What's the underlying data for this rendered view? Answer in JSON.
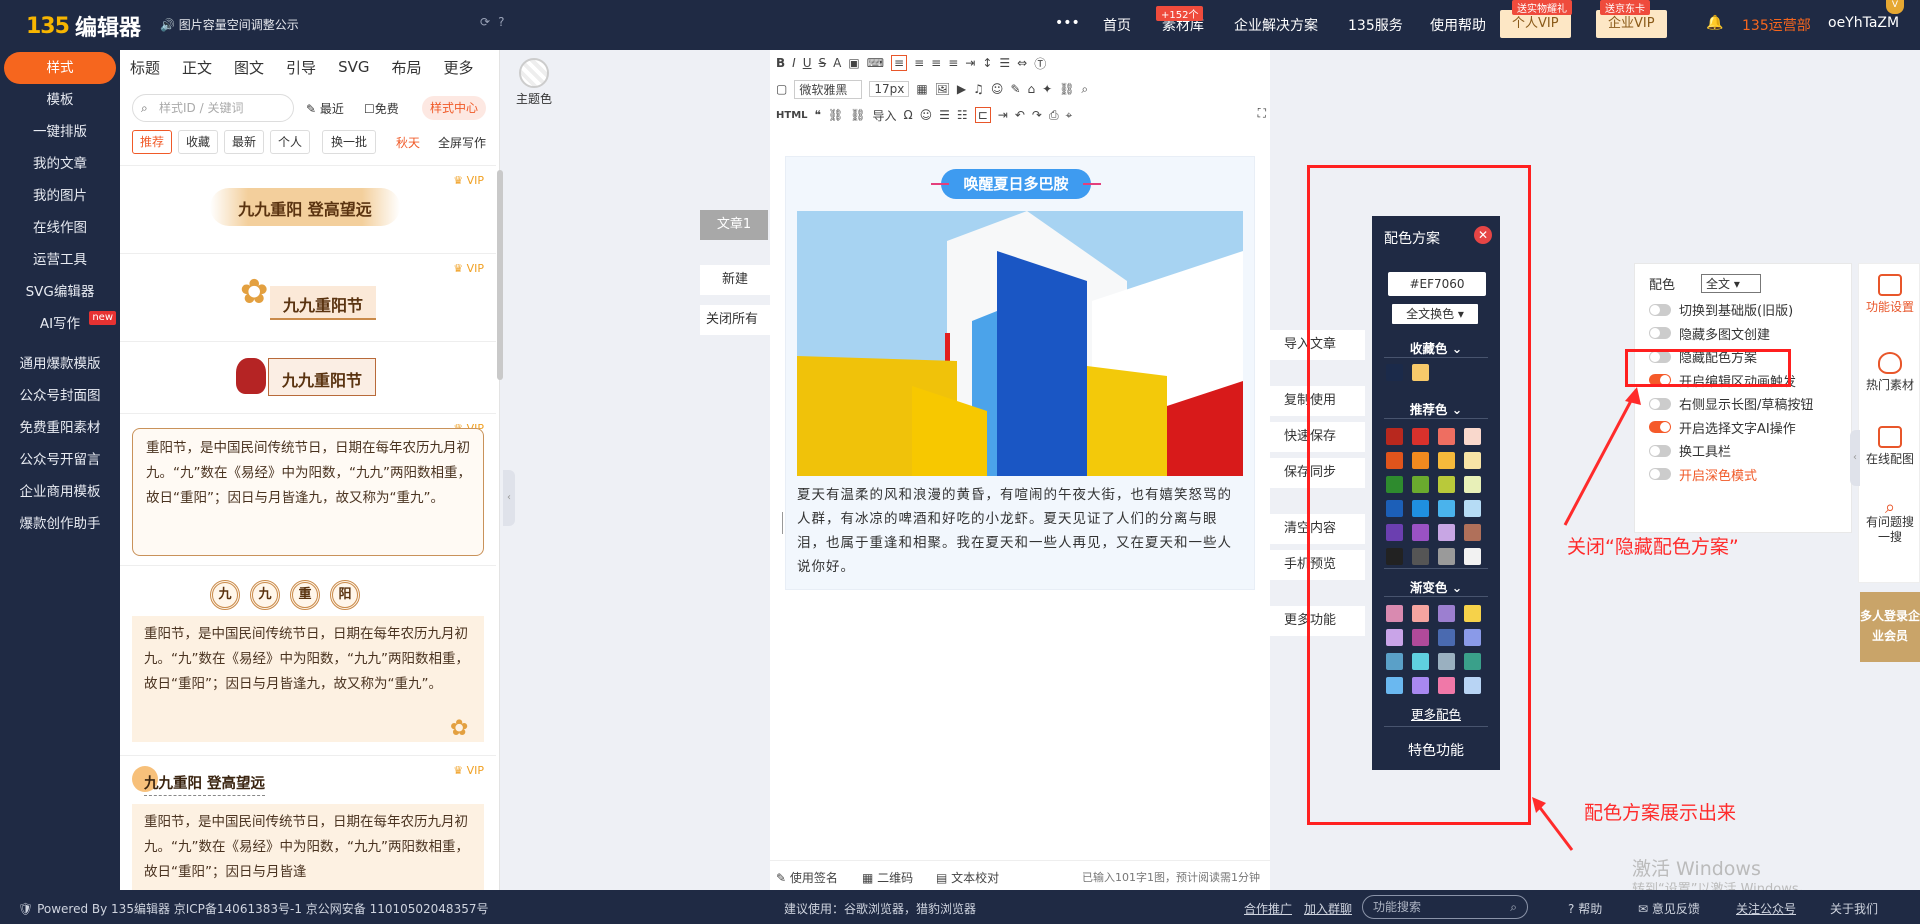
{
  "topbar": {
    "logo_mark": "135",
    "logo_name": "编辑器",
    "notice": "图片容量空间调整公示",
    "nav": [
      "首页",
      "素材库",
      "企业解决方案",
      "135服务",
      "使用帮助"
    ],
    "nav_badge": "+152个",
    "vip_personal": "个人VIP",
    "vip_personal_badge": "送实物耀礼",
    "vip_company": "企业VIP",
    "vip_company_badge": "送京东卡",
    "ops": "135运营部",
    "username": "oeYhTaZM"
  },
  "sidebar": {
    "items": [
      "样式",
      "模板",
      "一键排版",
      "我的文章",
      "我的图片",
      "在线作图",
      "运营工具",
      "SVG编辑器",
      "AI写作"
    ],
    "new_tag": "new",
    "extra": [
      "通用爆款模版",
      "公众号封面图",
      "免费重阳素材",
      "公众号开留言",
      "企业商用模板",
      "爆款创作助手"
    ]
  },
  "panel": {
    "tabs": [
      "标题",
      "正文",
      "图文",
      "引导",
      "SVG",
      "布局",
      "更多"
    ],
    "theme_label": "主题色",
    "search_placeholder": "样式ID / 关键词",
    "recent": "最近",
    "free": "免费",
    "style_center": "样式中心",
    "filters": [
      "推荐",
      "收藏",
      "最新",
      "个人",
      "换一批"
    ],
    "season": "秋天",
    "fullscreen": "全屏写作",
    "vip": "VIP",
    "tpl1": "九九重阳 登高望远",
    "tpl2": "九九重阳节",
    "tpl3": "九九重阳节",
    "tpl4_text": "重阳节，是中国民间传统节日，日期在每年农历九月初九。“九”数在《易经》中为阳数，“九九”两阳数相重，故日“重阳”；因日与月皆逢九，故又称为“重九”。",
    "tpl5_chars": [
      "九",
      "九",
      "重",
      "阳"
    ],
    "tpl5_text": "重阳节，是中国民间传统节日，日期在每年农历九月初九。“九”数在《易经》中为阳数，“九九”两阳数相重，故日“重阳”；因日与月皆逢九，故又称为“重九”。",
    "tpl6_title": "九九重阳 登高望远",
    "tpl6_text": "重阳节，是中国民间传统节日，日期在每年农历九月初九。“九”数在《易经》中为阳数，“九九”两阳数相重，故日“重阳”；因日与月皆逢"
  },
  "mid": {
    "article": "文章1",
    "new": "新建",
    "close_all": "关闭所有"
  },
  "editor": {
    "font": "微软雅黑",
    "size": "17px",
    "html": "HTML",
    "import": "导入",
    "doc_title": "唤醒夏日多巴胺",
    "doc_body": "夏天有温柔的风和浪漫的黄昏，有喧闹的午夜大街，也有嬉笑怒骂的人群，有冰凉的啤酒和好吃的小龙虾。夏天见证了人们的分离与眼泪，也属于重逢和相聚。我在夏天和一些人再见，又在夏天和一些人说你好。",
    "status_sign": "使用签名",
    "status_qr": "二维码",
    "status_check": "文本校对",
    "status_count": "已输入101字1图，预计阅读需1分钟"
  },
  "right_actions": [
    "导入文章",
    "复制使用",
    "快速保存",
    "保存同步",
    "清空内容",
    "手机预览",
    "更多功能"
  ],
  "color_scheme": {
    "title": "配色方案",
    "hex": "#EF7060",
    "mode": "全文换色",
    "fav": "收藏色",
    "fav_colors": [
      "#1b2a4a",
      "#f7c96a"
    ],
    "recommend": "推荐色",
    "recommend_colors": [
      [
        "#b8281e",
        "#d9312c",
        "#ee6e61",
        "#f9d8cc"
      ],
      [
        "#e0541c",
        "#f28a1f",
        "#f6b93b",
        "#f8e4a6"
      ],
      [
        "#2e8b2e",
        "#6aaa2e",
        "#b9c93a",
        "#e8f0b8"
      ],
      [
        "#1c5fb8",
        "#1f8fe0",
        "#4ab3ec",
        "#b6dcf5"
      ],
      [
        "#6b3fb0",
        "#9a52c4",
        "#c8a6e4",
        "#b0705a"
      ],
      [
        "#222222",
        "#555555",
        "#9a9a9a",
        "#f2f2f2"
      ]
    ],
    "gradient": "渐变色",
    "gradient_colors": [
      [
        "#d98ab0",
        "#f5a4a0",
        "#9c7fd0",
        "#f6d24a"
      ],
      [
        "#c9a4e8",
        "#b04a9a",
        "#4a6ab0",
        "#8a9ae8"
      ],
      [
        "#5aa0c8",
        "#5fd0e0",
        "#9ab0c0",
        "#3aa08a"
      ],
      [
        "#6ab8f0",
        "#a888f0",
        "#f078a8",
        "#b8d4f4"
      ]
    ],
    "more": "更多配色",
    "special": "特色功能"
  },
  "settings": {
    "color_label": "配色",
    "color_value": "全文",
    "rows": [
      {
        "label": "切换到基础版(旧版)",
        "on": false
      },
      {
        "label": "隐藏多图文创建",
        "on": false
      },
      {
        "label": "隐藏配色方案",
        "on": false
      },
      {
        "label": "开启编辑区动画触发",
        "on": true
      },
      {
        "label": "右侧显示长图/草稿按钮",
        "on": false
      },
      {
        "label": "开启选择文字AI操作",
        "on": true
      },
      {
        "label": "换工具栏",
        "on": false
      },
      {
        "label": "开启深色模式",
        "on": false
      }
    ]
  },
  "rightbar": [
    "功能设置",
    "热门素材",
    "在线配图",
    "有问题搜一搜"
  ],
  "multi_login": "多人登录企业会员",
  "annotations": {
    "close_hint": "关闭“隐藏配色方案”",
    "show_hint": "配色方案展示出来"
  },
  "footer": {
    "powered": "Powered By 135编辑器 京ICP备14061383号-1 京公网安备 11010502048357号",
    "browser": "建议使用：谷歌浏览器，猎豹浏览器",
    "links": [
      "合作推广",
      "加入群聊"
    ],
    "search_placeholder": "功能搜索",
    "help": "帮助",
    "feedback": "意见反馈",
    "follow": "关注公众号",
    "about": "关于我们"
  },
  "watermark": {
    "line1": "激活 Windows",
    "line2": "转到“设置”以激活 Windows。"
  }
}
